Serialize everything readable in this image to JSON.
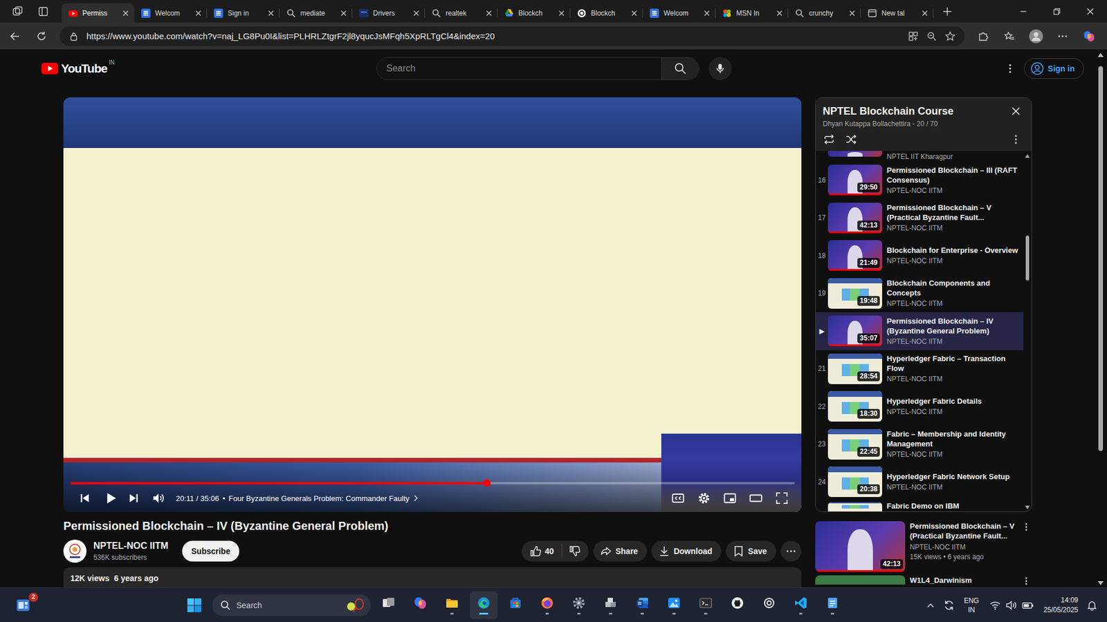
{
  "browser": {
    "tabs": [
      {
        "label": "Permiss",
        "kind": "youtube",
        "selected": true
      },
      {
        "label": "Welcom",
        "kind": "s-logo",
        "selected": false
      },
      {
        "label": "Sign in",
        "kind": "s-logo",
        "selected": false
      },
      {
        "label": "mediate",
        "kind": "search",
        "selected": false
      },
      {
        "label": "Drivers",
        "kind": "dark-page",
        "selected": false
      },
      {
        "label": "realtek",
        "kind": "search",
        "selected": false
      },
      {
        "label": "Blockch",
        "kind": "drive",
        "selected": false
      },
      {
        "label": "Blockch",
        "kind": "chatgpt",
        "selected": false
      },
      {
        "label": "Welcom",
        "kind": "s-logo",
        "selected": false
      },
      {
        "label": "MSN In",
        "kind": "msn",
        "selected": false
      },
      {
        "label": "crunchy",
        "kind": "search",
        "selected": false
      },
      {
        "label": "New tal",
        "kind": "newtab",
        "selected": false
      }
    ],
    "url": "https://www.youtube.com/watch?v=naj_LG8Pu0I&list=PLHRLZtgrF2jl8yqucJsMFqh5XpRLTgCl4&index=20"
  },
  "youtube": {
    "logo": "YouTube",
    "region": "IN",
    "search_placeholder": "Search",
    "sign_in": "Sign in"
  },
  "player": {
    "time": "20:11 / 35:06",
    "separator": "•",
    "chapter": "Four Byzantine Generals Problem: Commander Faulty",
    "level": 0.575,
    "playing": false
  },
  "video": {
    "title": "Permissioned Blockchain – IV (Byzantine General Problem)",
    "channel": "NPTEL-NOC IITM",
    "subscribers": "536K subscribers",
    "subscribe": "Subscribe",
    "likes": "40",
    "share": "Share",
    "download": "Download",
    "save": "Save",
    "views": "12K views",
    "age": "6 years ago"
  },
  "playlist": {
    "title": "NPTEL Blockchain Course",
    "subtitle": "Dhyan Kutappa Bollachettira - 20 / 70",
    "items": [
      {
        "kind": "partial-top",
        "channel": "NPTEL IIT Kharagpur",
        "thumb": "lecture",
        "selected": false
      },
      {
        "kind": "full",
        "index": "16",
        "title": "Permissioned Blockchain – III (RAFT Consensus)",
        "channel": "NPTEL-NOC IITM",
        "duration": "29:50",
        "thumb": "lecture",
        "progress": 1,
        "selected": false
      },
      {
        "kind": "full",
        "index": "17",
        "title": "Permissioned Blockchain – V (Practical Byzantine Fault...",
        "channel": "NPTEL-NOC IITM",
        "duration": "42:13",
        "thumb": "lecture",
        "progress": 1,
        "selected": false
      },
      {
        "kind": "full",
        "index": "18",
        "title": "Blockchain for Enterprise - Overview",
        "channel": "NPTEL-NOC IITM",
        "duration": "21:49",
        "thumb": "lecture",
        "progress": 1,
        "selected": false
      },
      {
        "kind": "full",
        "index": "19",
        "title": "Blockchain Components and Concepts",
        "channel": "NPTEL-NOC IITM",
        "duration": "19:48",
        "thumb": "slide",
        "progress": 0,
        "selected": false
      },
      {
        "kind": "full",
        "index": "▶",
        "title": "Permissioned Blockchain – IV (Byzantine General Problem)",
        "channel": "NPTEL-NOC IITM",
        "duration": "35:07",
        "thumb": "lecture",
        "progress": 1,
        "selected": true
      },
      {
        "kind": "full",
        "index": "21",
        "title": "Hyperledger Fabric – Transaction Flow",
        "channel": "NPTEL-NOC IITM",
        "duration": "28:54",
        "thumb": "slide",
        "progress": 0,
        "selected": false
      },
      {
        "kind": "full",
        "index": "22",
        "title": "Hyperledger Fabric Details",
        "channel": "NPTEL-NOC IITM",
        "duration": "18:30",
        "thumb": "slide",
        "progress": 0,
        "selected": false
      },
      {
        "kind": "full",
        "index": "23",
        "title": "Fabric – Membership and Identity Management",
        "channel": "NPTEL-NOC IITM",
        "duration": "22:45",
        "thumb": "slide",
        "progress": 0,
        "selected": false
      },
      {
        "kind": "full",
        "index": "24",
        "title": "Hyperledger Fabric Network Setup",
        "channel": "NPTEL-NOC IITM",
        "duration": "20:38",
        "thumb": "slide",
        "progress": 0,
        "selected": false
      },
      {
        "kind": "partial-bottom",
        "title": "Fabric Demo on IBM",
        "thumb": "slide",
        "selected": false
      }
    ]
  },
  "recommendations": [
    {
      "kind": "full",
      "title": "Permissioned Blockchain – V (Practical Byzantine Fault...",
      "channel": "NPTEL-NOC IITM",
      "meta": "15K views • 6 years ago",
      "duration": "42:13",
      "thumb": "lecture",
      "progress": 1
    },
    {
      "kind": "partial",
      "title": "W1L4_Darwinism",
      "thumb": "green"
    }
  ],
  "taskbar": {
    "widget_badge": "2",
    "search_placeholder": "Search",
    "apps": [
      {
        "kind": "task-view",
        "running": false,
        "active": false
      },
      {
        "kind": "copilot",
        "running": false,
        "active": false
      },
      {
        "kind": "explorer",
        "running": true,
        "active": false
      },
      {
        "kind": "edge",
        "running": true,
        "active": true
      },
      {
        "kind": "store",
        "running": false,
        "active": false
      },
      {
        "kind": "firefox",
        "running": true,
        "active": false
      },
      {
        "kind": "settings",
        "running": true,
        "active": false
      },
      {
        "kind": "app-gray",
        "running": true,
        "active": false
      },
      {
        "kind": "word",
        "running": true,
        "active": false
      },
      {
        "kind": "paint",
        "running": true,
        "active": false
      },
      {
        "kind": "terminal",
        "running": true,
        "active": false
      },
      {
        "kind": "github",
        "running": false,
        "active": false
      },
      {
        "kind": "chatgpt",
        "running": false,
        "active": false
      },
      {
        "kind": "vscode",
        "running": true,
        "active": false
      },
      {
        "kind": "notepad",
        "running": true,
        "active": false
      }
    ],
    "tray": {
      "language": "ENG",
      "region": "IN",
      "time": "14:09",
      "date": "25/05/2025"
    }
  }
}
